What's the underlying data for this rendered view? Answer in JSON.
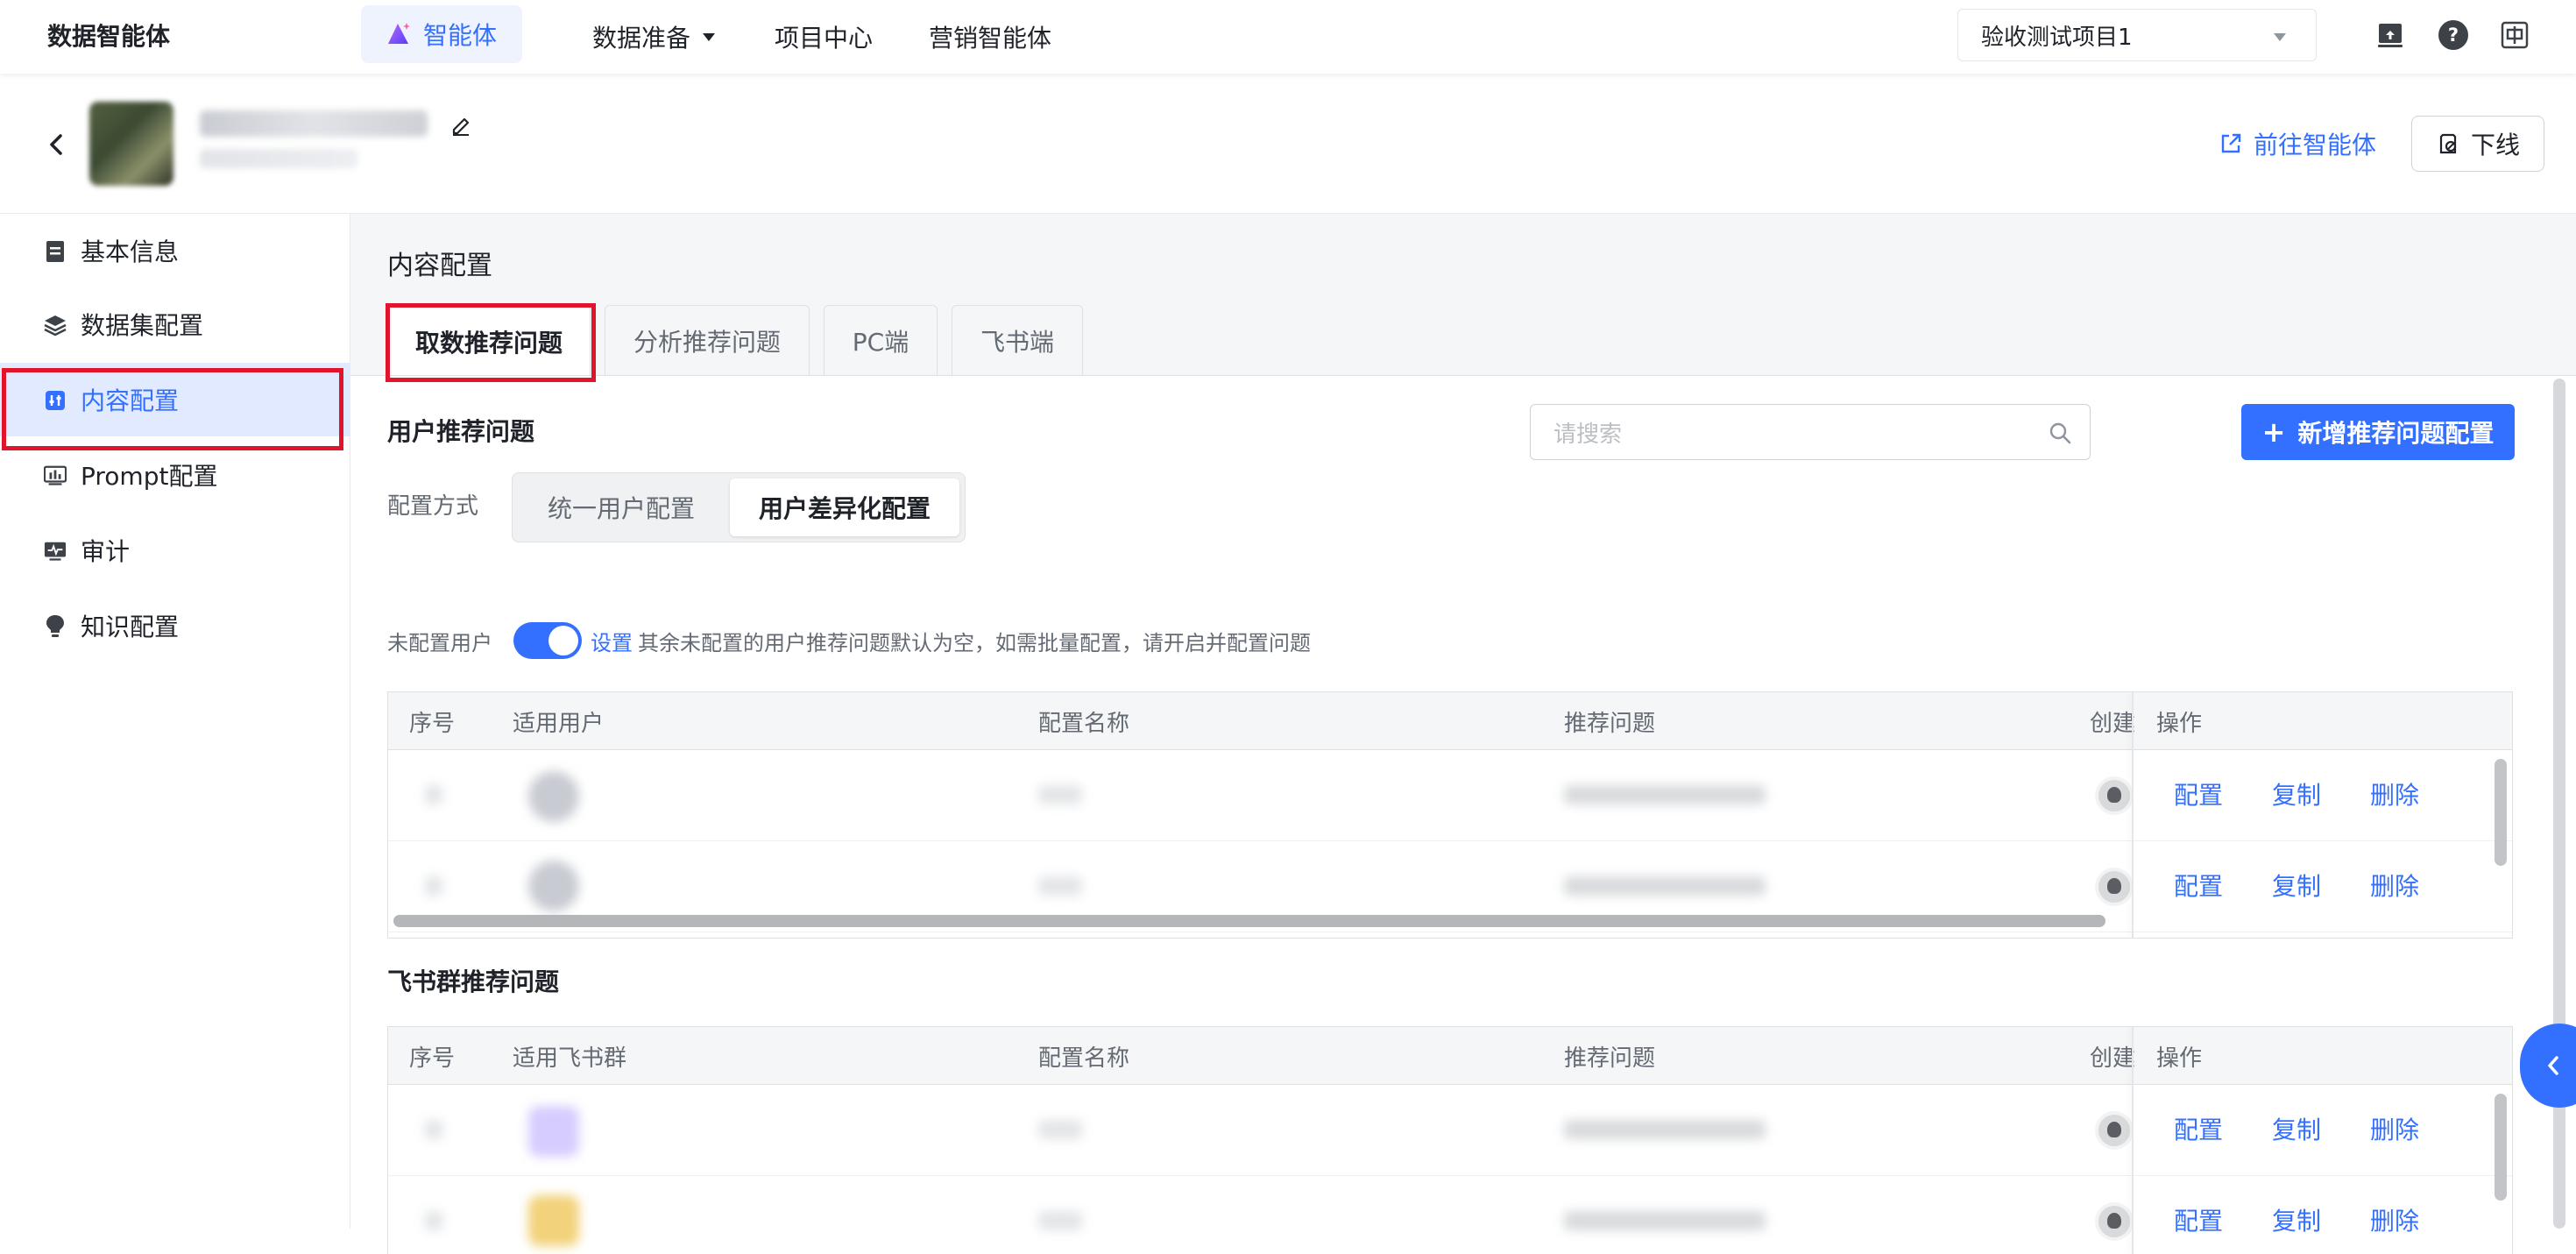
{
  "brand": "数据智能体",
  "nav": {
    "active_label": "智能体",
    "items": [
      "数据准备",
      "项目中心",
      "营销智能体"
    ]
  },
  "project_select": {
    "value": "验收测试项目1"
  },
  "top_icons": [
    "screen-share-icon",
    "help-icon",
    "chinese-lang-icon"
  ],
  "header": {
    "goto_label": "前往智能体",
    "offline_label": "下线"
  },
  "sidebar": {
    "items": [
      {
        "label": "基本信息",
        "icon": "document-icon"
      },
      {
        "label": "数据集配置",
        "icon": "layers-icon"
      },
      {
        "label": "内容配置",
        "icon": "content-config-icon"
      },
      {
        "label": "Prompt配置",
        "icon": "chart-icon"
      },
      {
        "label": "审计",
        "icon": "monitor-icon"
      },
      {
        "label": "知识配置",
        "icon": "bulb-icon"
      }
    ],
    "active_index": 2
  },
  "main": {
    "title": "内容配置",
    "tabs": [
      "取数推荐问题",
      "分析推荐问题",
      "PC端",
      "飞书端"
    ],
    "active_tab": 0
  },
  "user_section": {
    "title": "用户推荐问题",
    "search_placeholder": "请搜索",
    "add_button": "新增推荐问题配置",
    "config_mode_label": "配置方式",
    "modes": [
      "统一用户配置",
      "用户差异化配置"
    ],
    "active_mode": 1,
    "unconfigured_label": "未配置用户",
    "toggle_on": true,
    "set_link": "设置",
    "hint": "其余未配置的用户推荐问题默认为空，如需批量配置，请开启并配置问题",
    "columns": [
      "序号",
      "适用用户",
      "配置名称",
      "推荐问题",
      "创建",
      "操作"
    ],
    "row_actions": [
      "配置",
      "复制",
      "删除"
    ]
  },
  "group_section": {
    "title": "飞书群推荐问题",
    "columns": [
      "序号",
      "适用飞书群",
      "配置名称",
      "推荐问题",
      "创建",
      "操作"
    ],
    "row_actions": [
      "配置",
      "复制",
      "删除"
    ]
  },
  "colors": {
    "accent": "#3370ff",
    "highlight_box": "#e0142b",
    "sidebar_active_bg": "#e1eaff"
  }
}
